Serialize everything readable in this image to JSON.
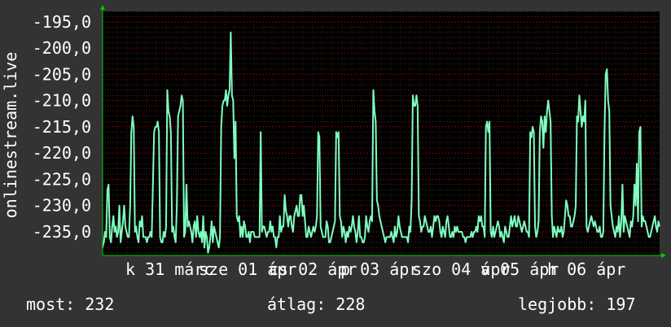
{
  "chart_data": {
    "type": "line",
    "ylabel": "onlinestream.live",
    "y_ticks": [
      -195,
      -200,
      -205,
      -210,
      -215,
      -220,
      -225,
      -230,
      -235
    ],
    "y_tick_labels": [
      "-195,0",
      "-200,0",
      "-205,0",
      "-210,0",
      "-215,0",
      "-220,0",
      "-225,0",
      "-230,0",
      "-235,0"
    ],
    "ylim": [
      -239.5,
      -193
    ],
    "x_tick_labels": [
      "k 31 márc",
      "sze 01 ápr",
      "cs 02 ápr",
      "p 03 ápr",
      "szo 04 ápr",
      "v 05 ápr",
      "h 06 ápr"
    ],
    "grid": true,
    "colors": {
      "background": "#333333",
      "plot": "#000000",
      "line": "#7fffbf",
      "grid_major": "#8b0000",
      "axis_arrow": "#00cc00",
      "text": "#ffffff"
    },
    "series": [
      {
        "values": [
          -238,
          -237,
          -235,
          -236,
          -227,
          -226,
          -236,
          -237,
          -234,
          -232,
          -235,
          -234,
          -236,
          -235,
          -230,
          -237,
          -235,
          -233,
          -230,
          -234,
          -235,
          -236,
          -236,
          -230,
          -216,
          -213,
          -215,
          -235,
          -234,
          -236,
          -237,
          -233,
          -234,
          -232,
          -236,
          -236,
          -236,
          -237,
          -236,
          -236,
          -235,
          -236,
          -226,
          -216,
          -215,
          -215,
          -214,
          -216,
          -236,
          -237,
          -237,
          -235,
          -236,
          -234,
          -208,
          -212,
          -213,
          -216,
          -235,
          -234,
          -236,
          -237,
          -230,
          -213,
          -212,
          -211,
          -209,
          -210,
          -236,
          -235,
          -226,
          -234,
          -233,
          -234,
          -235,
          -237,
          -234,
          -233,
          -236,
          -232,
          -235,
          -236,
          -235,
          -237,
          -232,
          -238,
          -235,
          -236,
          -239,
          -238,
          -236,
          -233,
          -237,
          -234,
          -235,
          -236,
          -237,
          -238,
          -236,
          -215,
          -211,
          -210,
          -210,
          -208,
          -211,
          -209,
          -208,
          -197,
          -209,
          -210,
          -221,
          -214,
          -232,
          -233,
          -232,
          -236,
          -234,
          -236,
          -233,
          -234,
          -236,
          -236,
          -235,
          -237,
          -235,
          -235,
          -235,
          -236,
          -236,
          -236,
          -236,
          -236,
          -216,
          -235,
          -234,
          -234,
          -235,
          -236,
          -235,
          -235,
          -233,
          -235,
          -234,
          -236,
          -236,
          -238,
          -236,
          -236,
          -232,
          -235,
          -234,
          -234,
          -228,
          -231,
          -232,
          -234,
          -232,
          -232,
          -234,
          -235,
          -232,
          -231,
          -230,
          -232,
          -232,
          -228,
          -228,
          -232,
          -230,
          -233,
          -236,
          -236,
          -234,
          -235,
          -236,
          -235,
          -234,
          -235,
          -234,
          -232,
          -216,
          -217,
          -234,
          -235,
          -236,
          -236,
          -236,
          -233,
          -234,
          -237,
          -237,
          -236,
          -235,
          -234,
          -233,
          -216,
          -217,
          -216,
          -232,
          -233,
          -236,
          -234,
          -235,
          -237,
          -235,
          -236,
          -234,
          -235,
          -234,
          -232,
          -234,
          -235,
          -237,
          -235,
          -232,
          -236,
          -236,
          -237,
          -237,
          -236,
          -232,
          -234,
          -235,
          -233,
          -232,
          -233,
          -208,
          -212,
          -214,
          -229,
          -230,
          -232,
          -233,
          -234,
          -235,
          -236,
          -237,
          -236,
          -236,
          -236,
          -236,
          -235,
          -236,
          -237,
          -234,
          -236,
          -235,
          -232,
          -234,
          -235,
          -236,
          -236,
          -236,
          -236,
          -236,
          -237,
          -234,
          -235,
          -229,
          -209,
          -211,
          -211,
          -209,
          -211,
          -232,
          -233,
          -235,
          -234,
          -234,
          -232,
          -233,
          -234,
          -235,
          -235,
          -234,
          -236,
          -234,
          -232,
          -233,
          -232,
          -232,
          -233,
          -235,
          -236,
          -234,
          -235,
          -236,
          -233,
          -232,
          -234,
          -236,
          -236,
          -235,
          -236,
          -234,
          -235,
          -234,
          -235,
          -235,
          -235,
          -235,
          -236,
          -236,
          -237,
          -236,
          -236,
          -236,
          -236,
          -235,
          -236,
          -235,
          -235,
          -234,
          -235,
          -232,
          -233,
          -232,
          -234,
          -234,
          -236,
          -215,
          -214,
          -216,
          -214,
          -235,
          -236,
          -234,
          -236,
          -235,
          -234,
          -233,
          -234,
          -236,
          -235,
          -236,
          -237,
          -234,
          -235,
          -236,
          -236,
          -234,
          -232,
          -234,
          -233,
          -232,
          -234,
          -234,
          -232,
          -233,
          -234,
          -235,
          -234,
          -233,
          -234,
          -235,
          -235,
          -236,
          -216,
          -217,
          -215,
          -216,
          -234,
          -236,
          -235,
          -233,
          -216,
          -213,
          -214,
          -219,
          -213,
          -216,
          -212,
          -210,
          -212,
          -214,
          -232,
          -236,
          -234,
          -235,
          -236,
          -234,
          -235,
          -235,
          -234,
          -236,
          -235,
          -232,
          -229,
          -230,
          -232,
          -232,
          -234,
          -234,
          -233,
          -232,
          -230,
          -213,
          -214,
          -209,
          -212,
          -215,
          -213,
          -214,
          -210,
          -234,
          -235,
          -234,
          -233,
          -232,
          -233,
          -234,
          -233,
          -234,
          -235,
          -235,
          -234,
          -236,
          -236,
          -235,
          -216,
          -205,
          -204,
          -210,
          -212,
          -230,
          -232,
          -234,
          -235,
          -236,
          -234,
          -235,
          -232,
          -236,
          -233,
          -226,
          -235,
          -232,
          -233,
          -234,
          -235,
          -236,
          -233,
          -234,
          -232,
          -226,
          -230,
          -222,
          -233,
          -216,
          -215,
          -234,
          -232,
          -233,
          -233,
          -234,
          -235,
          -236,
          -236,
          -235,
          -234,
          -233,
          -232,
          -234,
          -235,
          -233,
          -234
        ]
      }
    ]
  },
  "stats": {
    "current": "most: 232",
    "average": "átlag: 228",
    "best": "legjobb: 197"
  }
}
